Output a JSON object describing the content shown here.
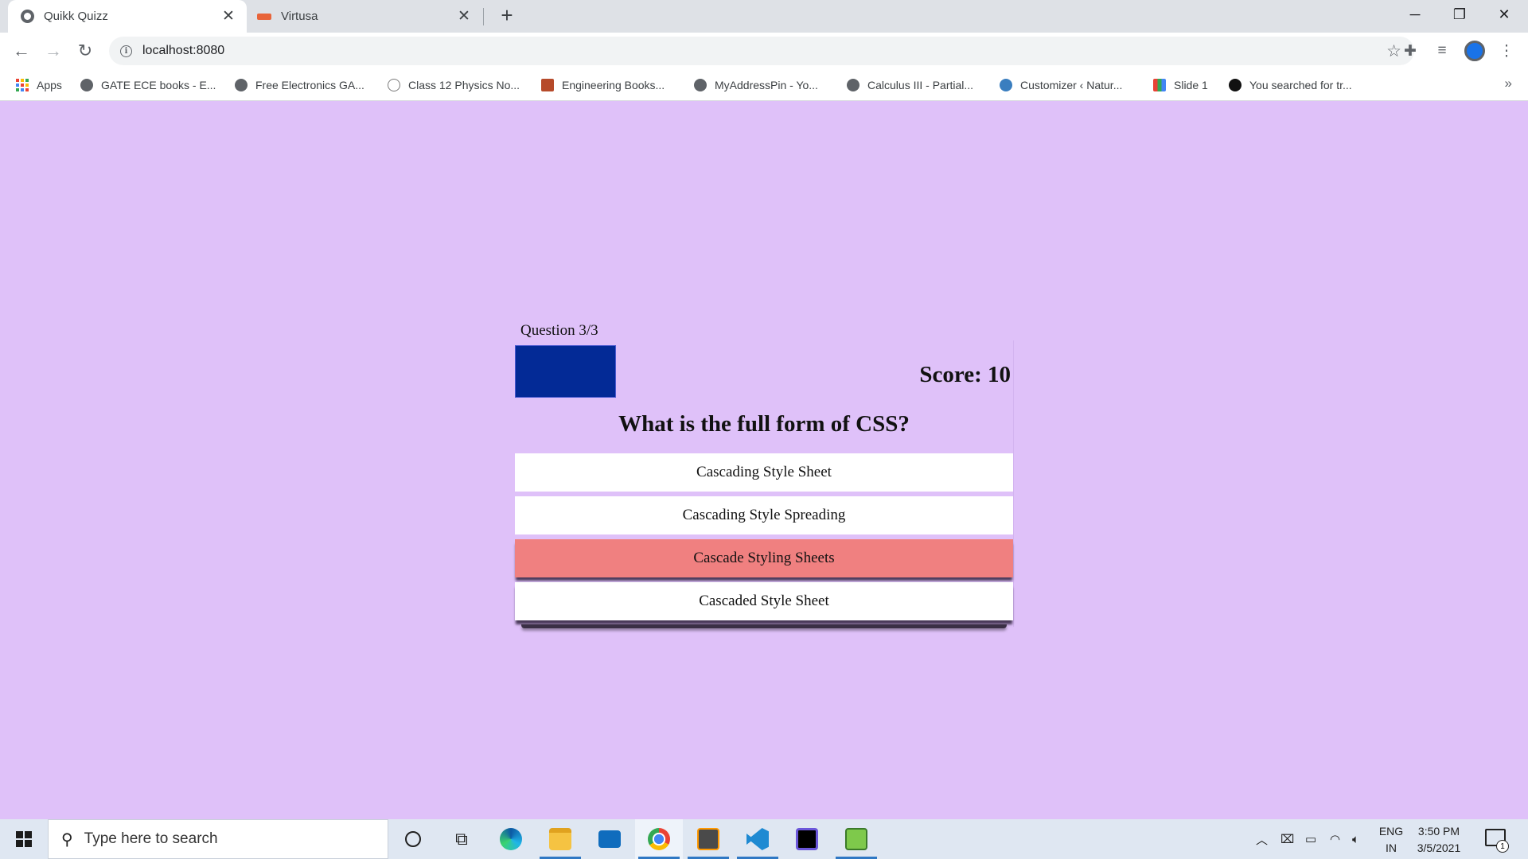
{
  "browser": {
    "tabs": [
      {
        "title": "Quikk Quizz",
        "active": true
      },
      {
        "title": "Virtusa",
        "active": false
      }
    ],
    "url": "localhost:8080",
    "bookmarks": [
      "Apps",
      "GATE ECE books - E...",
      "Free Electronics GA...",
      "Class 12 Physics No...",
      "Engineering Books...",
      "MyAddressPin - Yo...",
      "Calculus III - Partial...",
      "Customizer ‹ Natur...",
      "Slide 1",
      "You searched for tr..."
    ],
    "bookmarks_overflow": "»"
  },
  "quiz": {
    "question_counter": "Question 3/3",
    "score": "Score: 10",
    "question": "What is the full form of CSS?",
    "options": [
      {
        "label": "Cascading Style Sheet",
        "state": "default"
      },
      {
        "label": "Cascading Style Spreading",
        "state": "default"
      },
      {
        "label": "Cascade Styling Sheets",
        "state": "wrong"
      },
      {
        "label": "Cascaded Style Sheet",
        "state": "default"
      }
    ],
    "colors": {
      "page_background": "#dfc1f9",
      "timer_box": "#032a96",
      "wrong_answer": "#f08080"
    }
  },
  "taskbar": {
    "search_placeholder": "Type here to search",
    "language": [
      "ENG",
      "IN"
    ],
    "time": "3:50 PM",
    "date": "3/5/2021",
    "notification_count": "1",
    "apps": [
      "cortana-icon",
      "task-view-icon",
      "edge-icon",
      "file-explorer-icon",
      "mail-icon",
      "chrome-icon",
      "sublime-text-icon",
      "vscode-icon",
      "intellij-icon",
      "notepad-icon"
    ]
  }
}
